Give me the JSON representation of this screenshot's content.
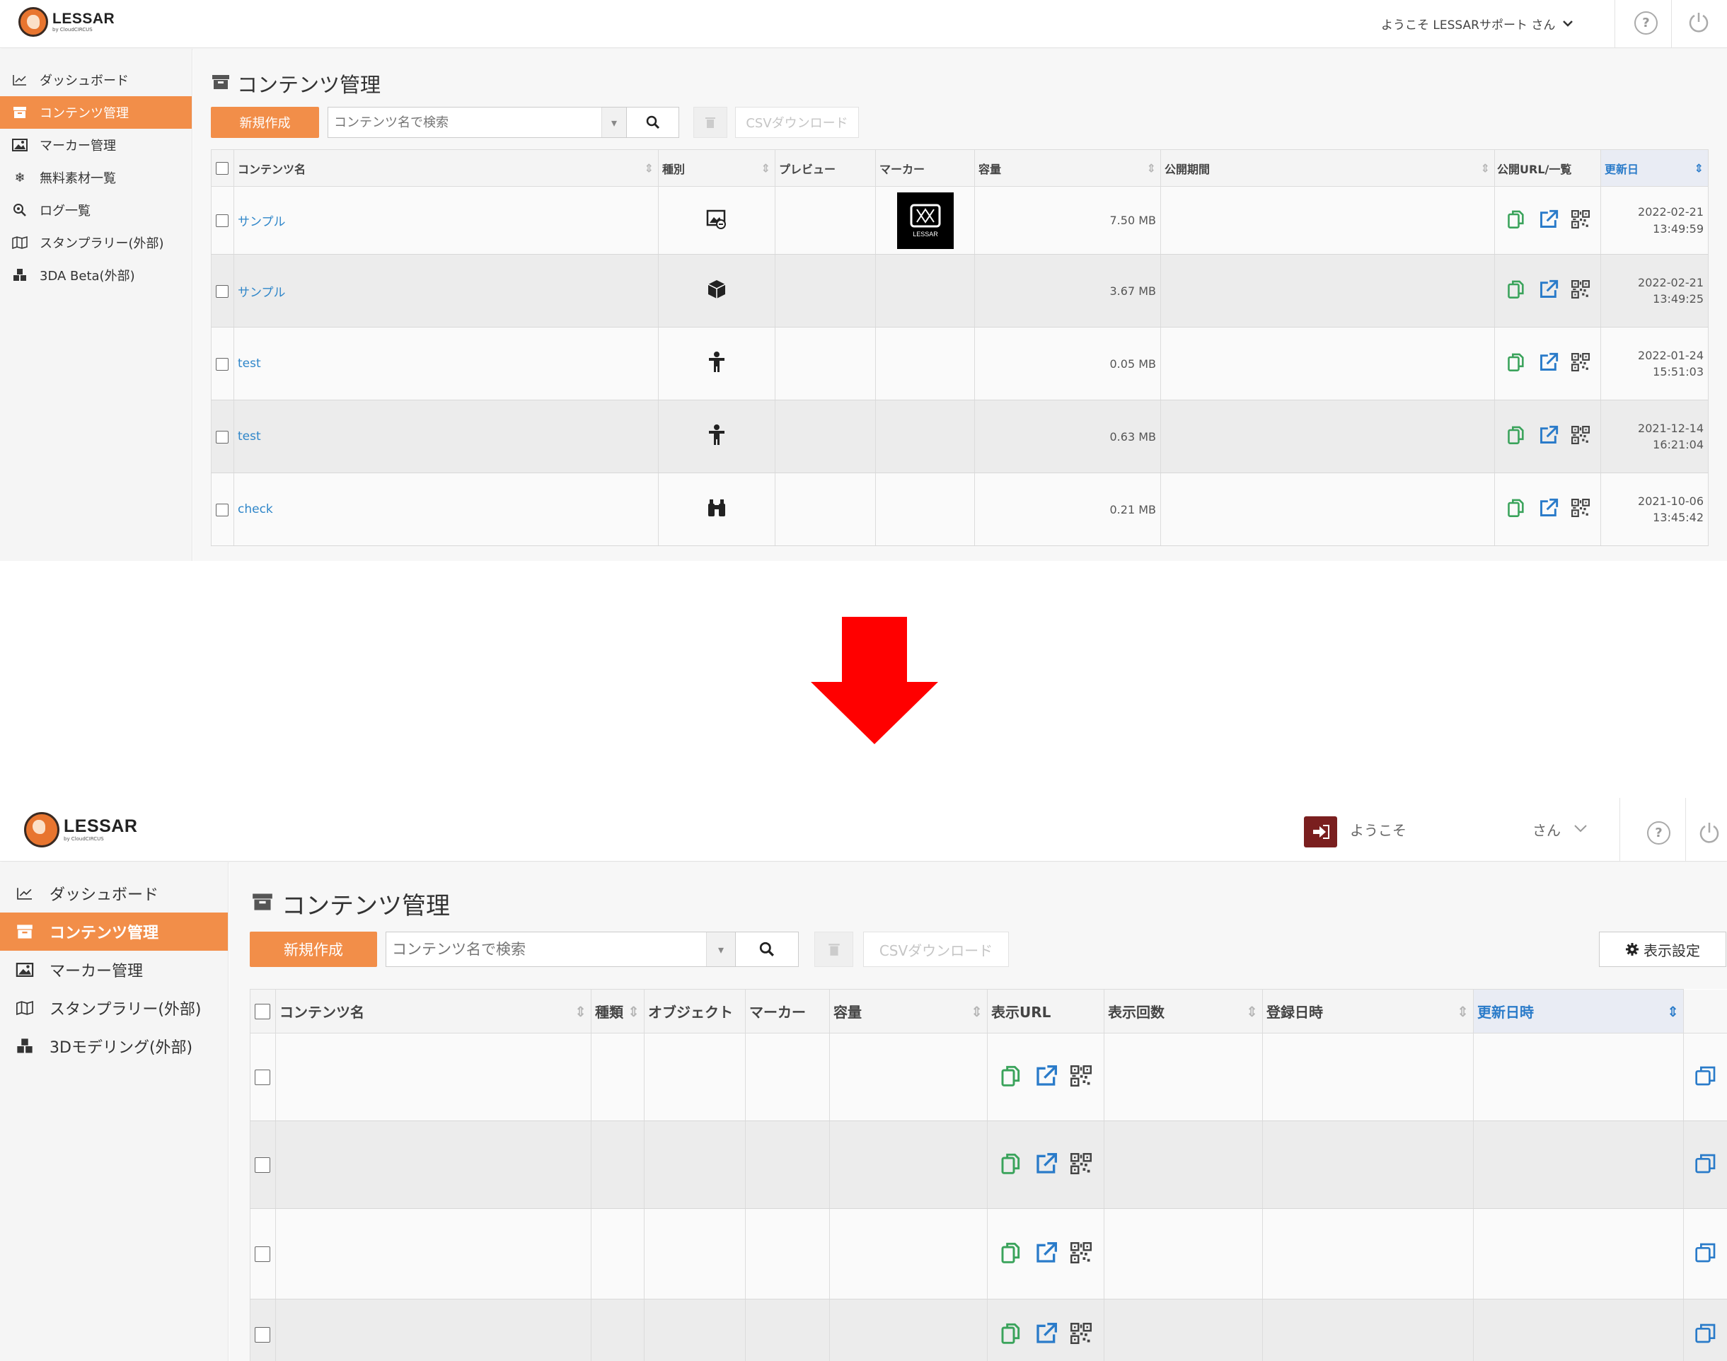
{
  "before": {
    "header": {
      "logo_name": "LESSAR",
      "logo_sub": "by CloudCIRCUS",
      "welcome": "ようこそ LESSARサポート さん",
      "help_glyph": "?",
      "power_glyph": "⏻"
    },
    "sidebar": {
      "items": [
        {
          "label": "ダッシュボード",
          "icon": "chart-line-icon"
        },
        {
          "label": "コンテンツ管理",
          "icon": "archive-icon",
          "active": true
        },
        {
          "label": "マーカー管理",
          "icon": "image-icon"
        },
        {
          "label": "無料素材一覧",
          "icon": "snowflake-icon"
        },
        {
          "label": "ログ一覧",
          "icon": "search-icon"
        },
        {
          "label": "スタンプラリー(外部)",
          "icon": "map-icon"
        },
        {
          "label": "3DA Beta(外部)",
          "icon": "cubes-icon"
        }
      ]
    },
    "main": {
      "title": "コンテンツ管理",
      "new_button": "新規作成",
      "search_placeholder": "コンテンツ名で検索",
      "csv_button": "CSVダウンロード",
      "columns": [
        "コンテンツ名",
        "種別",
        "プレビュー",
        "マーカー",
        "容量",
        "公開期間",
        "公開URL/一覧",
        "更新日"
      ],
      "marker_label": "LESSAR",
      "rows": [
        {
          "name": "サンプル",
          "type_icon": "image-ar-icon",
          "has_marker": true,
          "size": "7.50 MB",
          "date": "2022-02-21",
          "time": "13:49:59"
        },
        {
          "name": "サンプル",
          "type_icon": "cube-icon",
          "has_marker": false,
          "size": "3.67 MB",
          "date": "2022-02-21",
          "time": "13:49:25"
        },
        {
          "name": "test",
          "type_icon": "person-icon",
          "has_marker": false,
          "size": "0.05 MB",
          "date": "2022-01-24",
          "time": "15:51:03"
        },
        {
          "name": "test",
          "type_icon": "person-icon",
          "has_marker": false,
          "size": "0.63 MB",
          "date": "2021-12-14",
          "time": "16:21:04"
        },
        {
          "name": "check",
          "type_icon": "binoculars-icon",
          "has_marker": false,
          "size": "0.21 MB",
          "date": "2021-10-06",
          "time": "13:45:42"
        }
      ]
    }
  },
  "after": {
    "header": {
      "logo_name": "LESSAR",
      "logo_sub": "by CloudCIRCUS",
      "welcome": "ようこそ",
      "welcome_suffix": "さん",
      "help_glyph": "?",
      "power_glyph": "⏻"
    },
    "sidebar": {
      "items": [
        {
          "label": "ダッシュボード",
          "icon": "chart-line-icon"
        },
        {
          "label": "コンテンツ管理",
          "icon": "archive-icon",
          "active": true
        },
        {
          "label": "マーカー管理",
          "icon": "image-icon"
        },
        {
          "label": "スタンプラリー(外部)",
          "icon": "map-icon"
        },
        {
          "label": "3Dモデリング(外部)",
          "icon": "cubes-icon"
        }
      ]
    },
    "main": {
      "title": "コンテンツ管理",
      "new_button": "新規作成",
      "search_placeholder": "コンテンツ名で検索",
      "csv_button": "CSVダウンロード",
      "settings_button": "表示設定",
      "columns": [
        "コンテンツ名",
        "種類",
        "オブジェクト",
        "マーカー",
        "容量",
        "表示URL",
        "表示回数",
        "登録日時",
        "更新日時"
      ],
      "row_count": 4
    }
  },
  "colors": {
    "accent": "#f28e49",
    "link": "#2f86c9",
    "copy_icon": "#3aa35b",
    "external_icon": "#2a7bc9",
    "arrow": "#ff0000"
  }
}
